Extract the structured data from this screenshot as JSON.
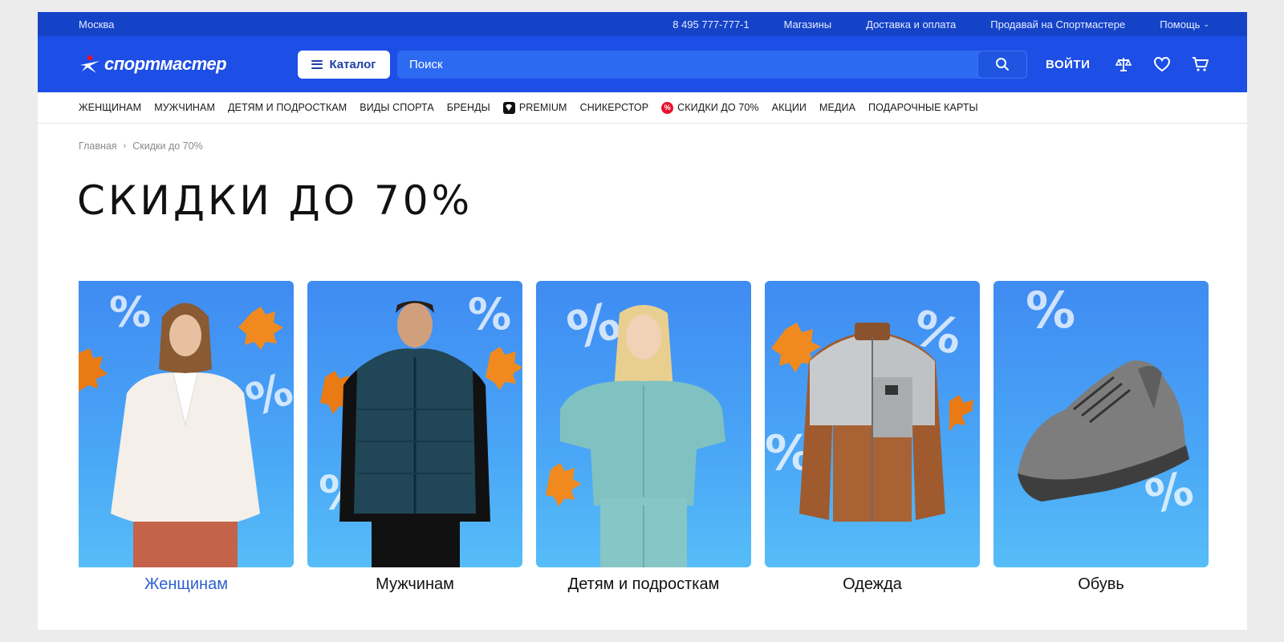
{
  "topbar": {
    "city": "Москва",
    "phone": "8 495 777-777-1",
    "stores": "Магазины",
    "delivery": "Доставка и оплата",
    "sell": "Продавай на Спортмастере",
    "help": "Помощь"
  },
  "header": {
    "logo_text": "спортмастер",
    "catalog_label": "Каталог",
    "search_placeholder": "Поиск",
    "login_label": "ВОЙТИ"
  },
  "nav": {
    "items": [
      "ЖЕНЩИНАМ",
      "МУЖЧИНАМ",
      "ДЕТЯМ И ПОДРОСТКАМ",
      "ВИДЫ СПОРТА",
      "БРЕНДЫ",
      "PREMIUM",
      "СНИКЕРСТОР",
      "СКИДКИ ДО 70%",
      "АКЦИИ",
      "МЕДИА",
      "ПОДАРОЧНЫЕ КАРТЫ"
    ]
  },
  "breadcrumb": {
    "home": "Главная",
    "current": "Скидки до 70%"
  },
  "page_title": "СКИДКИ ДО 70%",
  "categories": [
    {
      "label": "Женщинам",
      "image": "woman-white-fur-jacket"
    },
    {
      "label": "Мужчинам",
      "image": "man-dark-puffer-vest"
    },
    {
      "label": "Детям и подросткам",
      "image": "girl-mint-fleece-suit"
    },
    {
      "label": "Одежда",
      "image": "brown-grey-fleece-jacket"
    },
    {
      "label": "Обувь",
      "image": "grey-sneaker"
    }
  ],
  "colors": {
    "topbar": "#1543c8",
    "header": "#1d4ee6",
    "search": "#2d6af2",
    "active_link": "#2c5fd1",
    "sale_badge": "#e8112d"
  }
}
